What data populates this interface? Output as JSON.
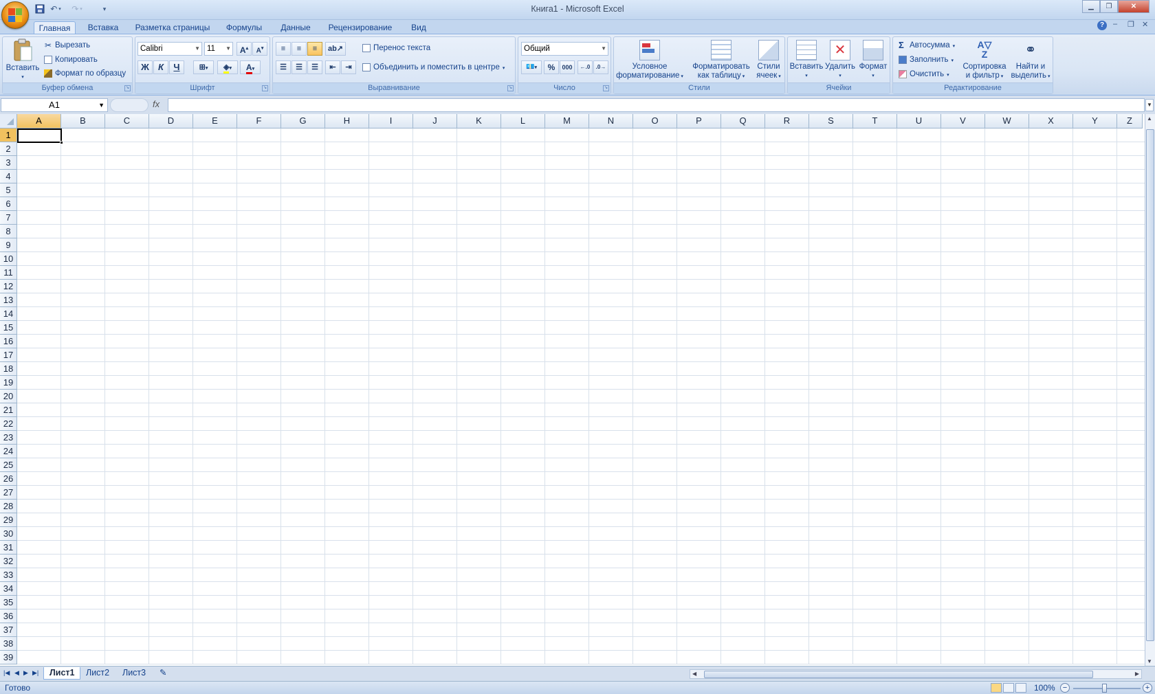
{
  "window": {
    "title": "Книга1 - Microsoft Excel"
  },
  "tabs": [
    "Главная",
    "Вставка",
    "Разметка страницы",
    "Формулы",
    "Данные",
    "Рецензирование",
    "Вид"
  ],
  "clipboard": {
    "label": "Буфер обмена",
    "paste": "Вставить",
    "cut": "Вырезать",
    "copy": "Копировать",
    "format_painter": "Формат по образцу"
  },
  "font": {
    "label": "Шрифт",
    "name": "Calibri",
    "size": "11",
    "bold": "Ж",
    "italic": "К",
    "underline": "Ч"
  },
  "alignment": {
    "label": "Выравнивание",
    "wrap_text": "Перенос текста",
    "merge_center": "Объединить и поместить в центре"
  },
  "number": {
    "label": "Число",
    "format": "Общий",
    "percent": "%",
    "thousands": "000"
  },
  "styles": {
    "label": "Стили",
    "conditional_l1": "Условное",
    "conditional_l2": "форматирование",
    "format_table_l1": "Форматировать",
    "format_table_l2": "как таблицу",
    "cell_styles_l1": "Стили",
    "cell_styles_l2": "ячеек"
  },
  "cells": {
    "label": "Ячейки",
    "insert": "Вставить",
    "delete": "Удалить",
    "format": "Формат"
  },
  "editing": {
    "label": "Редактирование",
    "autosum": "Автосумма",
    "fill": "Заполнить",
    "clear": "Очистить",
    "sort_l1": "Сортировка",
    "sort_l2": "и фильтр",
    "find_l1": "Найти и",
    "find_l2": "выделить"
  },
  "formula_bar": {
    "name_box": "A1",
    "fx": "fx",
    "value": ""
  },
  "sheet": {
    "columns": [
      "A",
      "B",
      "C",
      "D",
      "E",
      "F",
      "G",
      "H",
      "I",
      "J",
      "K",
      "L",
      "M",
      "N",
      "O",
      "P",
      "Q",
      "R",
      "S",
      "T",
      "U",
      "V",
      "W",
      "X",
      "Y",
      "Z"
    ],
    "rows": [
      "1",
      "2",
      "3",
      "4",
      "5",
      "6",
      "7",
      "8",
      "9",
      "10",
      "11",
      "12",
      "13",
      "14",
      "15",
      "16",
      "17",
      "18",
      "19",
      "20",
      "21",
      "22",
      "23",
      "24",
      "25",
      "26",
      "27",
      "28",
      "29",
      "30",
      "31",
      "32",
      "33",
      "34",
      "35",
      "36",
      "37",
      "38",
      "39"
    ],
    "active_cell": "A1"
  },
  "sheet_tabs": [
    "Лист1",
    "Лист2",
    "Лист3"
  ],
  "status": {
    "text": "Готово",
    "zoom": "100%"
  },
  "colors": {
    "accent": "#15428b",
    "selected_header": "#f1c15f",
    "ribbon": "#dae6f5"
  }
}
